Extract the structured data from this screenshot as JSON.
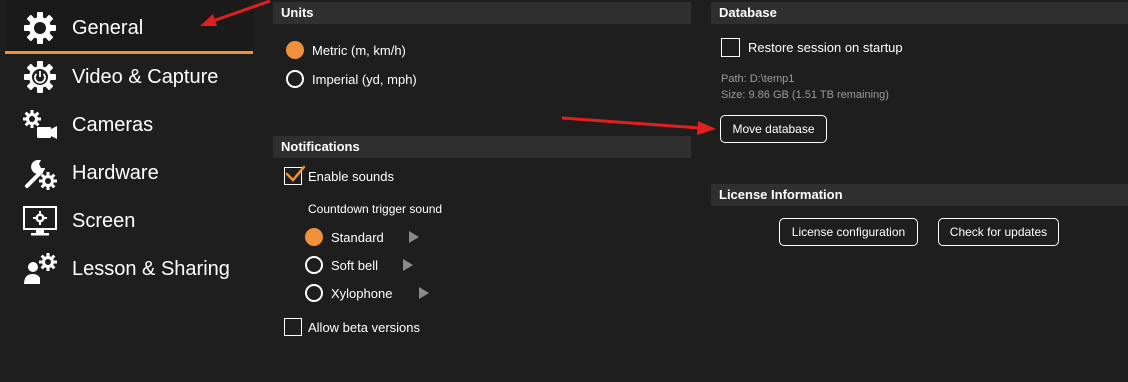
{
  "sidebar": {
    "items": [
      {
        "label": "General",
        "icon": "gear-icon"
      },
      {
        "label": "Video & Capture",
        "icon": "gear-power-icon"
      },
      {
        "label": "Cameras",
        "icon": "gear-camera-icon"
      },
      {
        "label": "Hardware",
        "icon": "wrench-gear-icon"
      },
      {
        "label": "Screen",
        "icon": "monitor-gear-icon"
      },
      {
        "label": "Lesson & Sharing",
        "icon": "people-gear-icon"
      }
    ],
    "active_index": 0
  },
  "units": {
    "header": "Units",
    "options": [
      "Metric (m, km/h)",
      "Imperial (yd, mph)"
    ],
    "selected": "Metric (m, km/h)"
  },
  "notifications": {
    "header": "Notifications",
    "enable_sounds_label": "Enable sounds",
    "enable_sounds_checked": true,
    "countdown_label": "Countdown trigger sound",
    "sounds": [
      "Standard",
      "Soft bell",
      "Xylophone"
    ],
    "selected_sound": "Standard",
    "beta_label": "Allow beta versions",
    "beta_checked": false
  },
  "database": {
    "header": "Database",
    "restore_label": "Restore session on startup",
    "restore_checked": false,
    "path_text": "Path: D:\\temp1",
    "size_text": "Size: 9.86 GB (1.51 TB remaining)",
    "move_button": "Move database"
  },
  "license": {
    "header": "License Information",
    "config_button": "License configuration",
    "updates_button": "Check for updates"
  },
  "colors": {
    "accent": "#f0903a",
    "background": "#1e1e1e",
    "header_bg": "#2f2f2f",
    "annotation_arrow": "#e02020"
  }
}
